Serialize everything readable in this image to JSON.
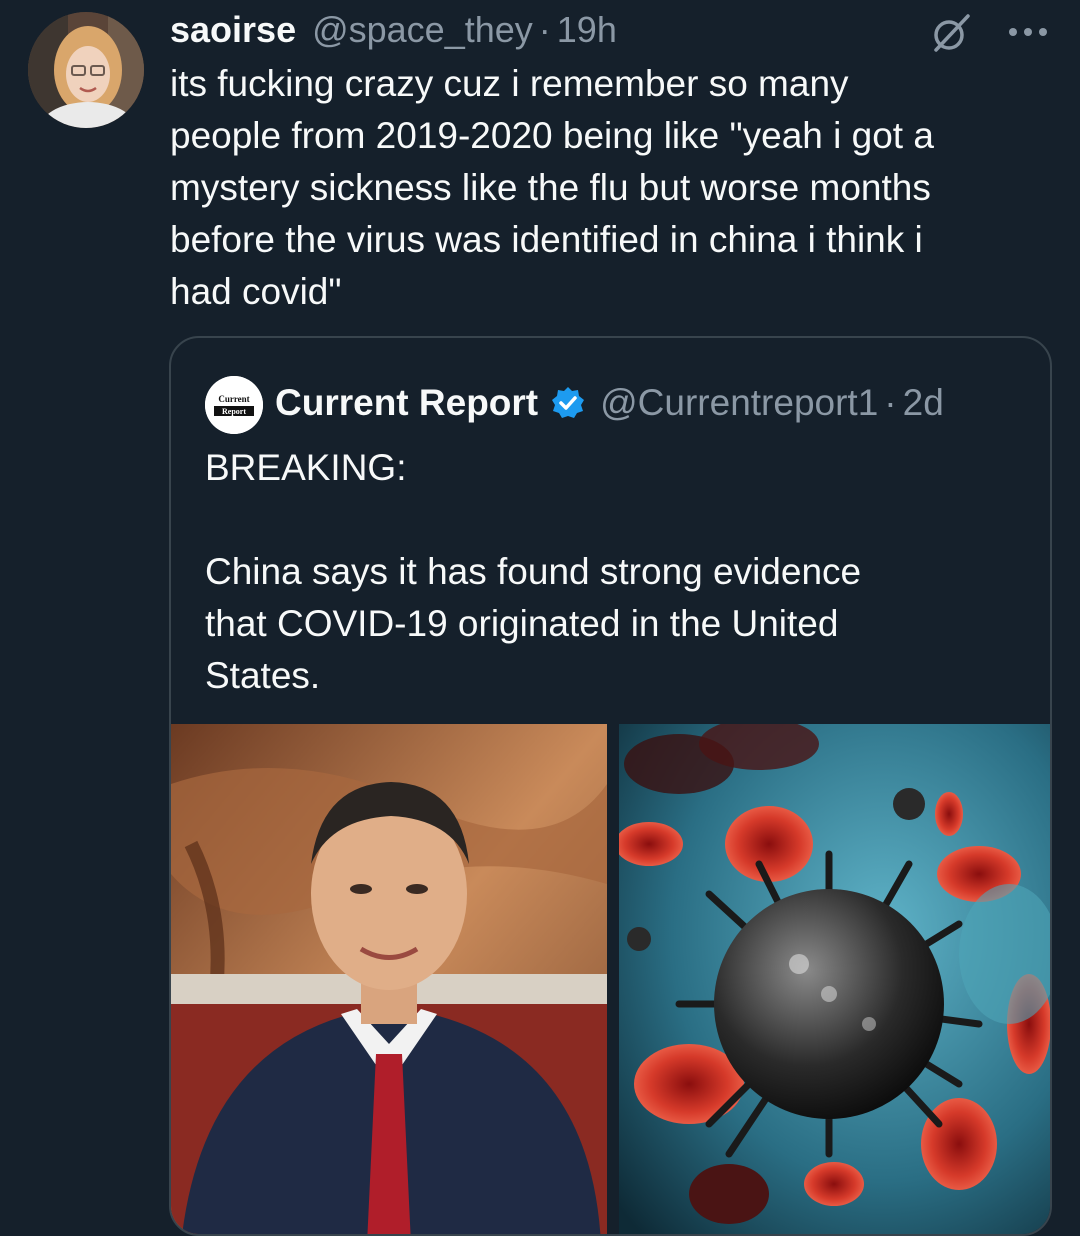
{
  "tweet": {
    "author": {
      "display_name": "saoirse",
      "handle": "@space_they",
      "separator": "·",
      "time": "19h",
      "avatar_icon": "user-avatar"
    },
    "text": "its fucking crazy cuz i remember so many\npeople from 2019-2020 being like \"yeah i got a\nmystery sickness like the flu but worse months\nbefore the virus was identified in china i think i\nhad covid\"",
    "icons": {
      "grok": "grok-icon",
      "more": "more-options-icon"
    }
  },
  "quote": {
    "author": {
      "display_name": "Current Report",
      "handle": "@Currentreport1",
      "separator": "·",
      "time": "2d",
      "verified": true,
      "avatar_logo_text_1": "Current",
      "avatar_logo_text_2": "Report"
    },
    "text": "BREAKING:\n\nChina says it has found strong evidence\nthat COVID-19 originated in the United\nStates.",
    "media": [
      {
        "kind": "photo",
        "subject": "man-in-suit-portrait"
      },
      {
        "kind": "photo",
        "subject": "virus-illustration"
      }
    ]
  },
  "colors": {
    "background": "#15202b",
    "text_primary": "#f7f9f9",
    "text_secondary": "#8b98a5",
    "border": "#38444d",
    "verified_blue": "#1d9bf0"
  }
}
